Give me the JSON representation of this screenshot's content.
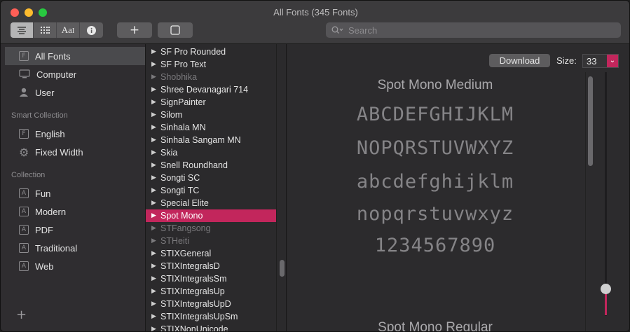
{
  "window": {
    "title": "All Fonts (345 Fonts)"
  },
  "toolbar": {
    "view_modes": [
      "sample-view",
      "grid-view",
      "repertoire-view",
      "info-view"
    ],
    "add_label": "+",
    "search_placeholder": "Search"
  },
  "sidebar": {
    "library_items": [
      {
        "label": "All Fonts",
        "icon": "font-library-icon",
        "selected": true
      },
      {
        "label": "Computer",
        "icon": "computer-icon"
      },
      {
        "label": "User",
        "icon": "user-icon"
      }
    ],
    "smart_collection_heading": "Smart Collection",
    "smart_items": [
      {
        "label": "English",
        "icon": "font-library-icon"
      },
      {
        "label": "Fixed Width",
        "icon": "gear-icon"
      }
    ],
    "collection_heading": "Collection",
    "collection_items": [
      {
        "label": "Fun"
      },
      {
        "label": "Modern"
      },
      {
        "label": "PDF"
      },
      {
        "label": "Traditional"
      },
      {
        "label": "Web"
      }
    ],
    "add_label": "+"
  },
  "font_list": [
    {
      "name": "SF Pro Rounded"
    },
    {
      "name": "SF Pro Text"
    },
    {
      "name": "Shobhika",
      "dim": true
    },
    {
      "name": "Shree Devanagari 714"
    },
    {
      "name": "SignPainter"
    },
    {
      "name": "Silom"
    },
    {
      "name": "Sinhala MN"
    },
    {
      "name": "Sinhala Sangam MN"
    },
    {
      "name": "Skia"
    },
    {
      "name": "Snell Roundhand"
    },
    {
      "name": "Songti SC"
    },
    {
      "name": "Songti TC"
    },
    {
      "name": "Special Elite"
    },
    {
      "name": "Spot Mono",
      "selected": true
    },
    {
      "name": "STFangsong",
      "dim": true
    },
    {
      "name": "STHeiti",
      "dim": true
    },
    {
      "name": "STIXGeneral"
    },
    {
      "name": "STIXIntegralsD"
    },
    {
      "name": "STIXIntegralsSm"
    },
    {
      "name": "STIXIntegralsUp"
    },
    {
      "name": "STIXIntegralsUpD"
    },
    {
      "name": "STIXIntegralsUpSm"
    },
    {
      "name": "STIXNonUnicode"
    }
  ],
  "preview": {
    "download_label": "Download",
    "size_label": "Size:",
    "size_value": "33",
    "size_level": 0.9,
    "title_medium": "Spot Mono Medium",
    "lines": [
      "ABCDEFGHIJKLM",
      "NOPQRSTUVWXYZ",
      "abcdefghijklm",
      "nopqrstuvwxyz",
      "1234567890"
    ],
    "title_regular": "Spot Mono Regular"
  },
  "colors": {
    "accent": "#c2265c"
  }
}
